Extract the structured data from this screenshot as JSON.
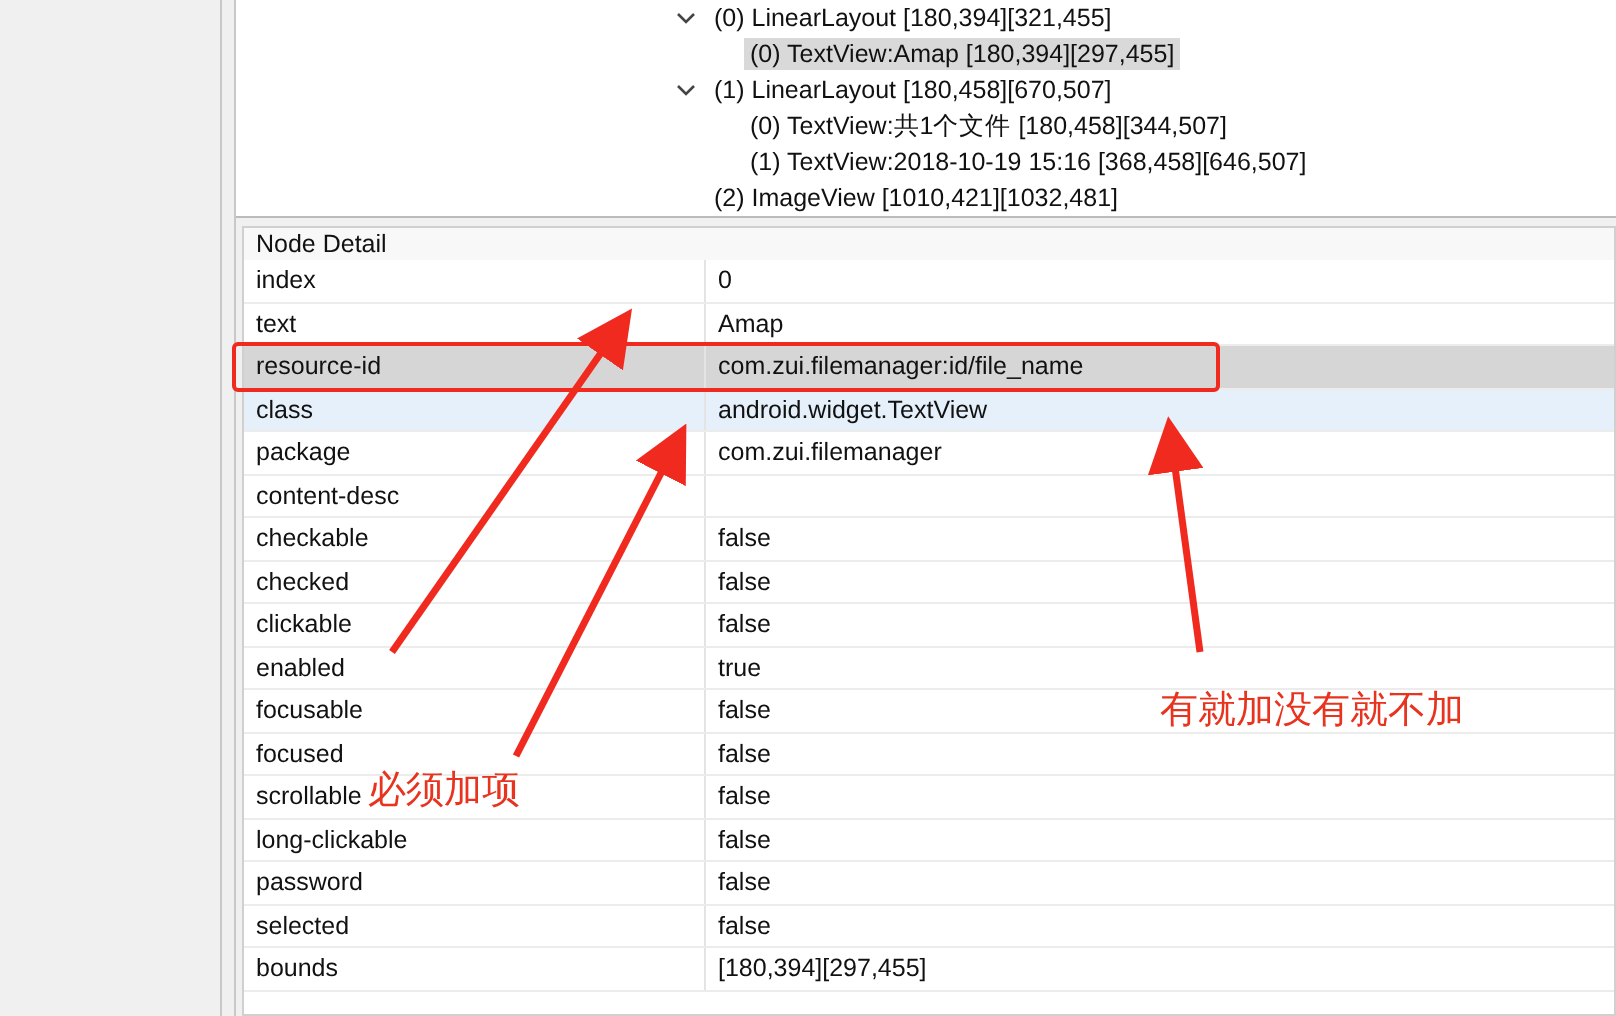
{
  "tree": [
    {
      "label": "(0) LinearLayout [180,394][321,455]",
      "expanded": true,
      "selected": false,
      "children": [
        {
          "label": "(0) TextView:Amap [180,394][297,455]",
          "selected": true
        }
      ]
    },
    {
      "label": "(1) LinearLayout [180,458][670,507]",
      "expanded": true,
      "selected": false,
      "children": [
        {
          "label": "(0) TextView:共1个文件 [180,458][344,507]",
          "selected": false
        },
        {
          "label": "(1) TextView:2018-10-19 15:16 [368,458][646,507]",
          "selected": false
        }
      ]
    },
    {
      "label": "(2) ImageView [1010,421][1032,481]",
      "selected": false
    }
  ],
  "node_detail": {
    "title": "Node Detail",
    "rows": [
      {
        "key": "index",
        "value": "0",
        "selected": false,
        "hovered": false
      },
      {
        "key": "text",
        "value": "Amap",
        "selected": false,
        "hovered": false
      },
      {
        "key": "resource-id",
        "value": "com.zui.filemanager:id/file_name",
        "selected": true,
        "hovered": false
      },
      {
        "key": "class",
        "value": "android.widget.TextView",
        "selected": false,
        "hovered": true
      },
      {
        "key": "package",
        "value": "com.zui.filemanager",
        "selected": false,
        "hovered": false
      },
      {
        "key": "content-desc",
        "value": "",
        "selected": false,
        "hovered": false
      },
      {
        "key": "checkable",
        "value": "false",
        "selected": false,
        "hovered": false
      },
      {
        "key": "checked",
        "value": "false",
        "selected": false,
        "hovered": false
      },
      {
        "key": "clickable",
        "value": "false",
        "selected": false,
        "hovered": false
      },
      {
        "key": "enabled",
        "value": "true",
        "selected": false,
        "hovered": false
      },
      {
        "key": "focusable",
        "value": "false",
        "selected": false,
        "hovered": false
      },
      {
        "key": "focused",
        "value": "false",
        "selected": false,
        "hovered": false
      },
      {
        "key": "scrollable",
        "value": "false",
        "selected": false,
        "hovered": false
      },
      {
        "key": "long-clickable",
        "value": "false",
        "selected": false,
        "hovered": false
      },
      {
        "key": "password",
        "value": "false",
        "selected": false,
        "hovered": false
      },
      {
        "key": "selected",
        "value": "false",
        "selected": false,
        "hovered": false
      },
      {
        "key": "bounds",
        "value": "[180,394][297,455]",
        "selected": false,
        "hovered": false
      }
    ]
  },
  "annotations": [
    {
      "text": "必须加项"
    },
    {
      "text": "有就加没有就不加"
    }
  ]
}
